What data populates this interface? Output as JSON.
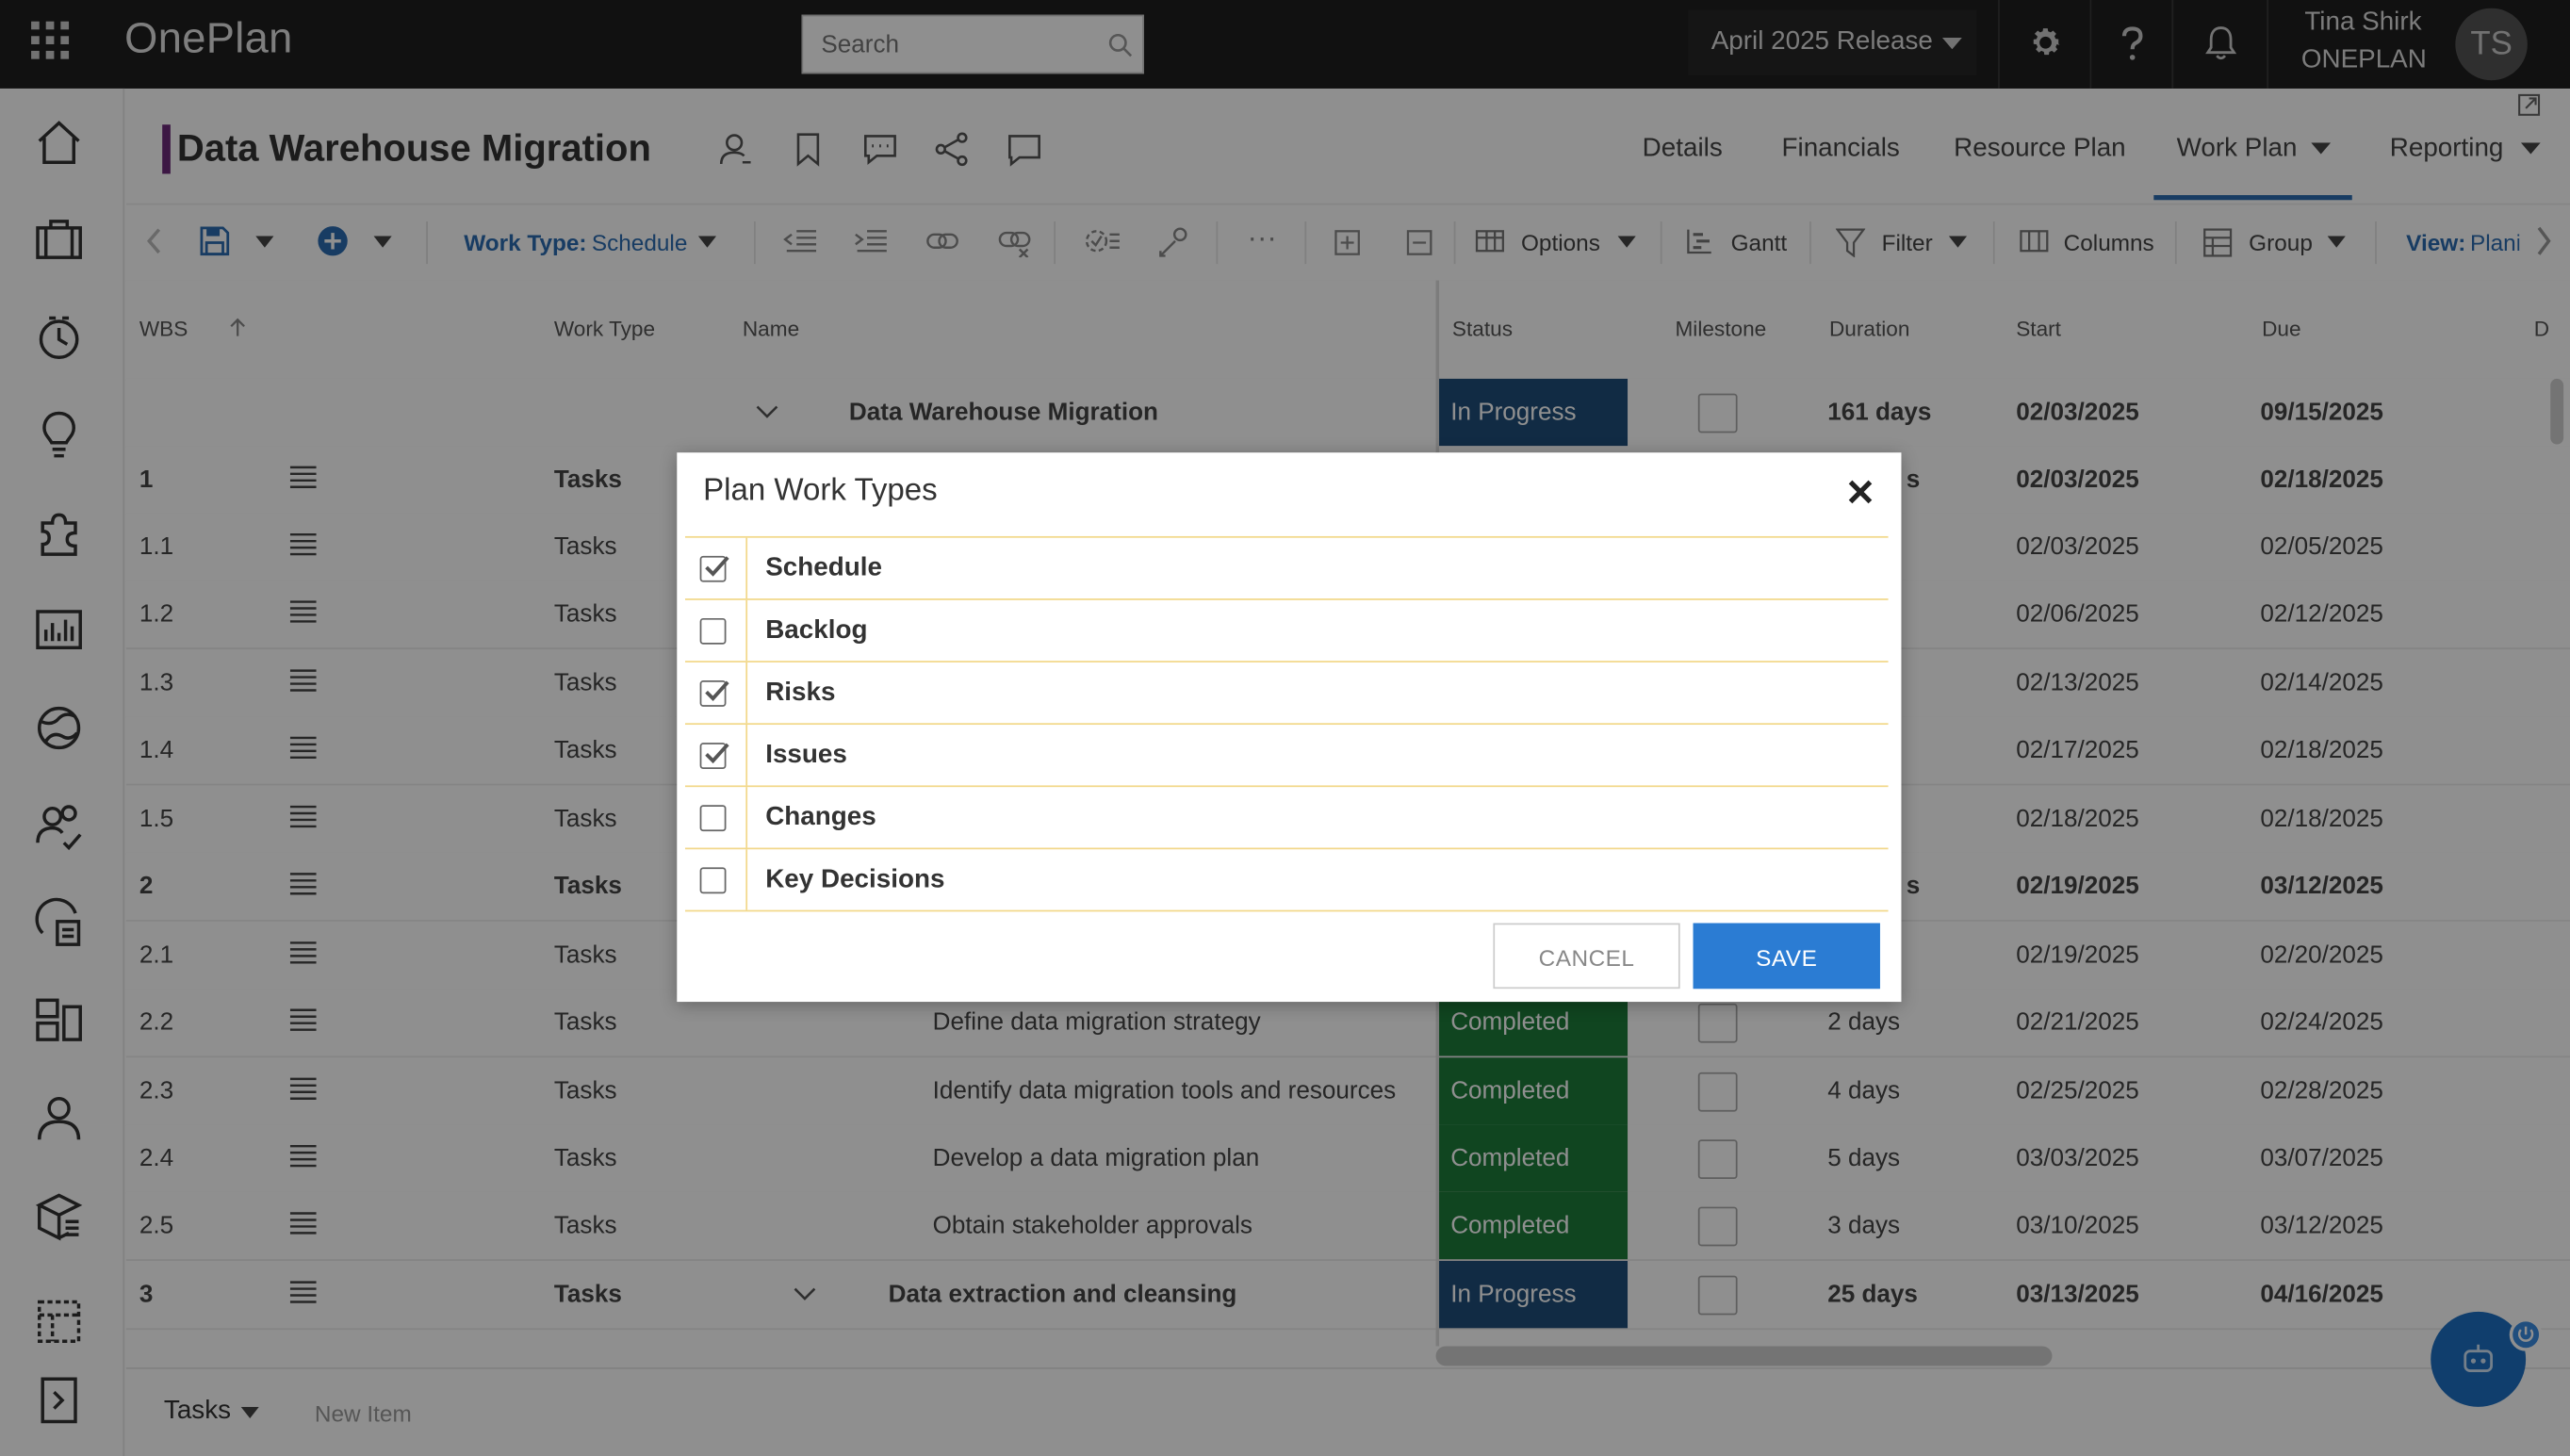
{
  "app": {
    "name": "OnePlan"
  },
  "search": {
    "placeholder": "Search"
  },
  "release": {
    "label": "April 2025 Release"
  },
  "user": {
    "name": "Tina Shirk",
    "org": "ONEPLAN",
    "initials": "TS"
  },
  "page": {
    "title": "Data Warehouse Migration"
  },
  "tabs": [
    {
      "label": "Details"
    },
    {
      "label": "Financials"
    },
    {
      "label": "Resource Plan"
    },
    {
      "label": "Work Plan"
    },
    {
      "label": "Reporting"
    }
  ],
  "toolbar": {
    "work_type_label": "Work Type:",
    "work_type_value": "Schedule",
    "options": "Options",
    "gantt": "Gantt",
    "filter": "Filter",
    "columns": "Columns",
    "group": "Group",
    "view_label": "View:",
    "view_value": "Plani",
    "more": "···"
  },
  "grid": {
    "headers": {
      "wbs": "WBS",
      "work_type": "Work Type",
      "name": "Name",
      "status": "Status",
      "milestone": "Milestone",
      "duration": "Duration",
      "start": "Start",
      "due": "Due",
      "extra": "D"
    },
    "rows": [
      {
        "wbs": "",
        "work_type": "",
        "name": "Data Warehouse Migration",
        "status": "In Progress",
        "duration": "161 days",
        "start": "02/03/2025",
        "due": "09/15/2025",
        "bold": true
      },
      {
        "wbs": "1",
        "work_type": "Tasks",
        "name": "",
        "status": "",
        "duration": "s",
        "start": "02/03/2025",
        "due": "02/18/2025",
        "bold": true
      },
      {
        "wbs": "1.1",
        "work_type": "Tasks",
        "name": "",
        "status": "",
        "duration": "",
        "start": "02/03/2025",
        "due": "02/05/2025",
        "bold": false
      },
      {
        "wbs": "1.2",
        "work_type": "Tasks",
        "name": "",
        "status": "",
        "duration": "",
        "start": "02/06/2025",
        "due": "02/12/2025",
        "bold": false
      },
      {
        "wbs": "1.3",
        "work_type": "Tasks",
        "name": "",
        "status": "",
        "duration": "",
        "start": "02/13/2025",
        "due": "02/14/2025",
        "bold": false
      },
      {
        "wbs": "1.4",
        "work_type": "Tasks",
        "name": "",
        "status": "",
        "duration": "",
        "start": "02/17/2025",
        "due": "02/18/2025",
        "bold": false
      },
      {
        "wbs": "1.5",
        "work_type": "Tasks",
        "name": "",
        "status": "",
        "duration": "",
        "start": "02/18/2025",
        "due": "02/18/2025",
        "bold": false
      },
      {
        "wbs": "2",
        "work_type": "Tasks",
        "name": "",
        "status": "",
        "duration": "s",
        "start": "02/19/2025",
        "due": "03/12/2025",
        "bold": true
      },
      {
        "wbs": "2.1",
        "work_type": "Tasks",
        "name": "",
        "status": "",
        "duration": "",
        "start": "02/19/2025",
        "due": "02/20/2025",
        "bold": false
      },
      {
        "wbs": "2.2",
        "work_type": "Tasks",
        "name": "Define data migration strategy",
        "status": "Completed",
        "duration": "2 days",
        "start": "02/21/2025",
        "due": "02/24/2025",
        "bold": false
      },
      {
        "wbs": "2.3",
        "work_type": "Tasks",
        "name": "Identify data migration tools and resources",
        "status": "Completed",
        "duration": "4 days",
        "start": "02/25/2025",
        "due": "02/28/2025",
        "bold": false
      },
      {
        "wbs": "2.4",
        "work_type": "Tasks",
        "name": "Develop a data migration plan",
        "status": "Completed",
        "duration": "5 days",
        "start": "03/03/2025",
        "due": "03/07/2025",
        "bold": false
      },
      {
        "wbs": "2.5",
        "work_type": "Tasks",
        "name": "Obtain stakeholder approvals",
        "status": "Completed",
        "duration": "3 days",
        "start": "03/10/2025",
        "due": "03/12/2025",
        "bold": false
      },
      {
        "wbs": "3",
        "work_type": "Tasks",
        "name": "Data extraction and cleansing",
        "status": "In Progress",
        "duration": "25 days",
        "start": "03/13/2025",
        "due": "04/16/2025",
        "bold": true
      }
    ]
  },
  "footer": {
    "type_label": "Tasks",
    "new_item": "New Item"
  },
  "colors": {
    "in_progress": "#1f4e79",
    "completed": "#1e7b3a",
    "accent": "#2b7cd3"
  },
  "modal": {
    "title": "Plan Work Types",
    "items": [
      {
        "label": "Schedule",
        "checked": true
      },
      {
        "label": "Backlog",
        "checked": false
      },
      {
        "label": "Risks",
        "checked": true
      },
      {
        "label": "Issues",
        "checked": true
      },
      {
        "label": "Changes",
        "checked": false
      },
      {
        "label": "Key Decisions",
        "checked": false
      }
    ],
    "cancel": "CANCEL",
    "save": "SAVE"
  }
}
